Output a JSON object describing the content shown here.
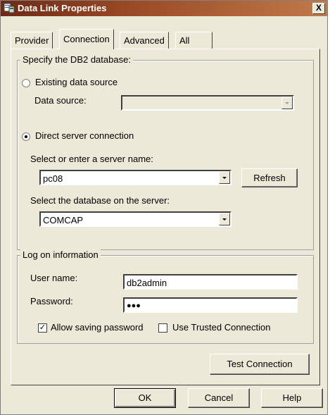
{
  "window": {
    "title": "Data Link Properties",
    "close_label": "X"
  },
  "tabs": [
    {
      "label": "Provider"
    },
    {
      "label": "Connection",
      "active": true
    },
    {
      "label": "Advanced"
    },
    {
      "label": "All"
    }
  ],
  "db_group": {
    "label": "Specify the DB2 database:",
    "existing_source_label": "Existing data source",
    "existing_source_selected": false,
    "data_source_label": "Data source:",
    "data_source_value": "",
    "direct_connection_label": "Direct server connection",
    "direct_connection_selected": true,
    "server_label": "Select or enter a server name:",
    "server_value": "pc08",
    "refresh_label": "Refresh",
    "database_label": "Select the database on the server:",
    "database_value": "COMCAP"
  },
  "logon_group": {
    "label": "Log on information",
    "username_label": "User name:",
    "username_value": "db2admin",
    "password_label": "Password:",
    "password_value": "●●●",
    "allow_saving_label": "Allow saving password",
    "allow_saving_checked": true,
    "trusted_label": "Use Trusted Connection",
    "trusted_checked": false
  },
  "buttons": {
    "test_connection": "Test Connection",
    "ok": "OK",
    "cancel": "Cancel",
    "help": "Help"
  },
  "colors": {
    "titlebar_start": "#6e2a16",
    "titlebar_end": "#c07a4a",
    "dialog_face": "#ece9d8"
  },
  "icons": {
    "title_icon": "data-link-icon",
    "dropdown_icon": "chevron-down-icon"
  }
}
